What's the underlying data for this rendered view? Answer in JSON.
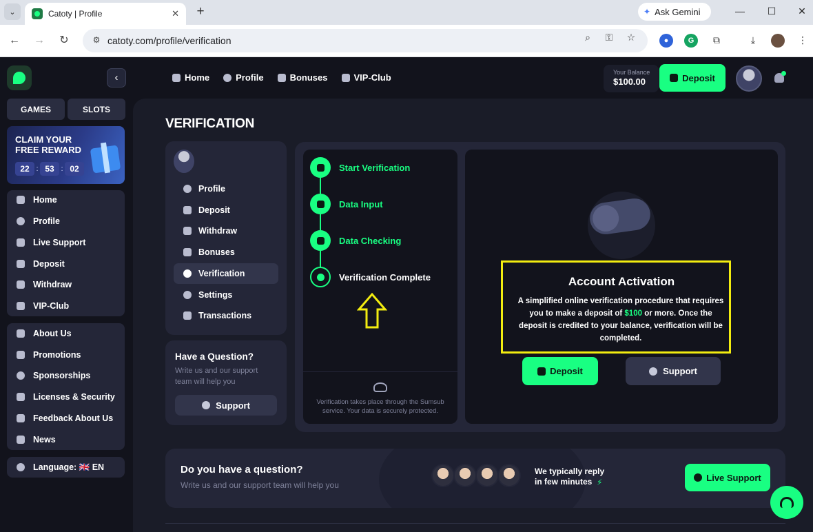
{
  "browser": {
    "tab_title": "Catoty | Profile",
    "tab_close": "✕",
    "new_tab": "+",
    "ask_gemini": "Ask Gemini",
    "url": "catoty.com/profile/verification"
  },
  "sidebar": {
    "games": "GAMES",
    "slots": "SLOTS",
    "claim": {
      "title": "CLAIM YOUR FREE REWARD",
      "hours": "22",
      "minutes": "53",
      "seconds": "02"
    },
    "group1": [
      "Home",
      "Profile",
      "Live Support",
      "Deposit",
      "Withdraw",
      "VIP-Club"
    ],
    "group2": [
      "About Us",
      "Promotions",
      "Sponsorships",
      "Licenses & Security",
      "Feedback About Us",
      "News"
    ],
    "language": "Language:",
    "language_value": "🇬🇧 EN"
  },
  "topnav": {
    "items": [
      "Home",
      "Profile",
      "Bonuses",
      "VIP-Club"
    ],
    "balance_label": "Your Balance",
    "balance_value": "$100.00",
    "deposit": "Deposit"
  },
  "page": {
    "title": "VERIFICATION"
  },
  "profile_menu": {
    "items": [
      "Profile",
      "Deposit",
      "Withdraw",
      "Bonuses",
      "Verification",
      "Settings",
      "Transactions"
    ],
    "active": "Verification"
  },
  "question_card": {
    "title": "Have a Question?",
    "text": "Write us and our support team will help you",
    "button": "Support"
  },
  "steps": {
    "items": [
      "Start Verification",
      "Data Input",
      "Data Checking",
      "Verification Complete"
    ],
    "note": "Verification takes place through the Sumsub service. Your data is securely protected."
  },
  "activation": {
    "title": "Account Activation",
    "text_before": "A simplified online verification procedure that requires you to make a deposit of ",
    "amount": "$100",
    "text_after": " or more. Once the deposit is credited to your balance, verification will be completed.",
    "deposit_button": "Deposit",
    "support_button": "Support"
  },
  "faq": {
    "title": "Do you have a question?",
    "text": "Write us and our support team will help you",
    "reply_line1": "We typically reply",
    "reply_line2": "in few minutes",
    "button": "Live Support"
  },
  "colors": {
    "accent": "#19ff82",
    "highlight": "#f2ec10",
    "background": "#12131c",
    "card": "#242638"
  }
}
